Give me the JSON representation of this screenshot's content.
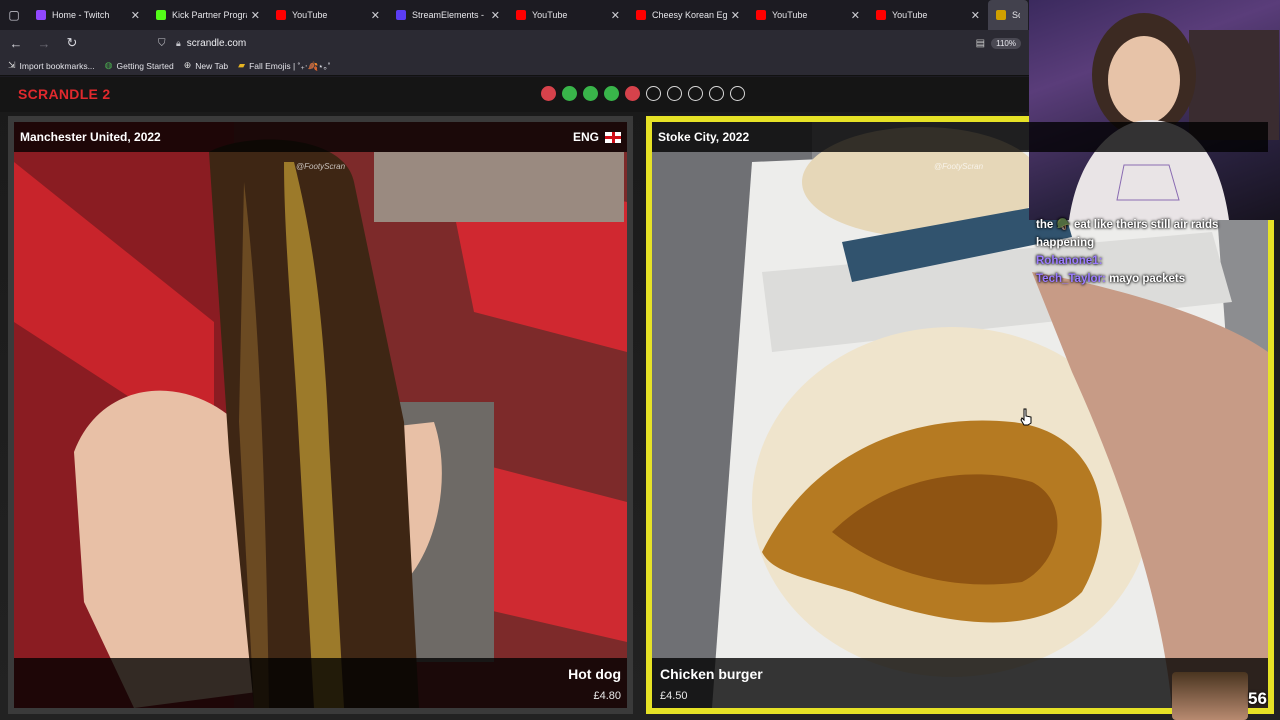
{
  "browser": {
    "tabs": [
      {
        "title": "Home - Twitch",
        "color": "#9147ff"
      },
      {
        "title": "Kick Partner Program -",
        "color": "#53fc18"
      },
      {
        "title": "YouTube",
        "color": "#ff0000"
      },
      {
        "title": "StreamElements - My c",
        "color": "#5b3df5"
      },
      {
        "title": "YouTube",
        "color": "#ff0000"
      },
      {
        "title": "Cheesy Korean Egg To:",
        "color": "#ff0000"
      },
      {
        "title": "YouTube",
        "color": "#ff0000"
      },
      {
        "title": "YouTube",
        "color": "#ff0000"
      },
      {
        "title": "Scran",
        "color": "#d0a000"
      }
    ],
    "url": "scrandle.com",
    "zoom": "110%",
    "bookmarks": [
      {
        "label": "Import bookmarks...",
        "icon": "import-icon"
      },
      {
        "label": "Getting Started",
        "icon": "firefox-icon"
      },
      {
        "label": "New Tab",
        "icon": "globe-icon"
      },
      {
        "label": "Fall Emojis | ˚₊‧🍂⋆｡˚",
        "icon": "folder-icon"
      }
    ]
  },
  "game": {
    "brand": "SCRANDLE 2",
    "progress": [
      "red",
      "green",
      "green",
      "green",
      "red",
      "empty",
      "empty",
      "empty",
      "empty",
      "empty"
    ],
    "left": {
      "club": "Manchester United, 2022",
      "country": "ENG",
      "watermark": "@FootyScran",
      "dish": "Hot dog",
      "price": "£4.80"
    },
    "right": {
      "club": "Stoke City, 2022",
      "watermark": "@FootyScran",
      "dish": "Chicken burger",
      "price": "£4.50",
      "border_color": "#e6e226"
    }
  },
  "stream": {
    "chat": {
      "line1": "the 🪖 eat like theirs still air raids happening",
      "user2": "Rohanone1:",
      "user3": "Tech_Taylor:",
      "msg3": "mayo packets"
    },
    "counter": "56"
  }
}
